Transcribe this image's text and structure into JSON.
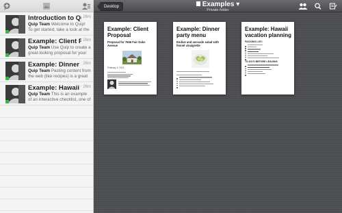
{
  "sidebar": {
    "threads": [
      {
        "title": "Introduction to Quip",
        "time": "26m",
        "author": "Quip Team",
        "snippet": "Welcome to Quip! To get started, take a look at the docume..."
      },
      {
        "title": "Example: Client Propo",
        "time": "26m",
        "author": "Quip Team",
        "snippet": "Use Quip to create a great-looking proposal for your cli..."
      },
      {
        "title": "Example: Dinner part...",
        "time": "26m",
        "author": "Quip Team",
        "snippet": "Pasting content from the web (like recipes) is a great wa..."
      },
      {
        "title": "Example: Hawaii vaca...",
        "time": "26m",
        "author": "Quip Team",
        "snippet": "This is an example of an interactive checklist, one of the thr..."
      }
    ]
  },
  "topbar": {
    "back_label": "Desktop",
    "folder_title": "Examples",
    "folder_subtitle": "Private folder"
  },
  "documents": [
    {
      "title": "Example: Client Proposal",
      "subtitle": "Proposal for 7656 Fair Oaks Avenue",
      "date": "February 3, 2013"
    },
    {
      "title": "Example: Dinner party menu",
      "subtitle": "Endive and avocado salad with fennel vinaigrette"
    },
    {
      "title": "Example: Hawaii vacation planning",
      "section1": "PACKING LIST:",
      "section2": "TO DO'S BEFORE LEAVING:"
    }
  ],
  "colors": {
    "online": "#3cb54a",
    "topbar": "#4b4c50",
    "background": "#4d4e52"
  }
}
